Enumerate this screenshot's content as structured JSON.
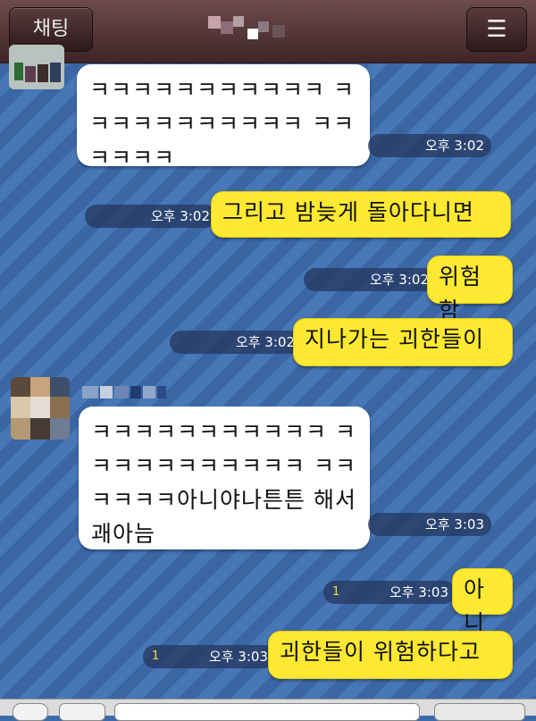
{
  "header": {
    "back_label": "채팅",
    "menu_icon": "menu-icon"
  },
  "messages": [
    {
      "side": "left",
      "text": "ㅋㅋㅋㅋㅋㅋㅋㅋㅋㅋㅋ ㅋㅋㅋㅋㅋㅋㅋㅋㅋㅋㅋ ㅋㅋㅋㅋㅋㅋ",
      "time": "오후 3:02"
    },
    {
      "side": "right",
      "text": "그리고 밤늦게 돌아다니면",
      "time": "오후 3:02"
    },
    {
      "side": "right",
      "text": "위험함",
      "time": "오후 3:02"
    },
    {
      "side": "right",
      "text": "지나가는 괴한들이",
      "time": "오후 3:02"
    },
    {
      "side": "left",
      "text": "ㅋㅋㅋㅋㅋㅋㅋㅋㅋㅋㅋ ㅋㅋㅋㅋㅋㅋㅋㅋㅋㅋㅋ ㅋㅋㅋㅋㅋㅋ아니야나튼튼 해서괘아늠",
      "time": "오후 3:03"
    },
    {
      "side": "right",
      "text": "아니",
      "time": "오후 3:03",
      "unread": "1"
    },
    {
      "side": "right",
      "text": "괴한들이 위험하다고",
      "time": "오후 3:03",
      "unread": "1"
    }
  ]
}
